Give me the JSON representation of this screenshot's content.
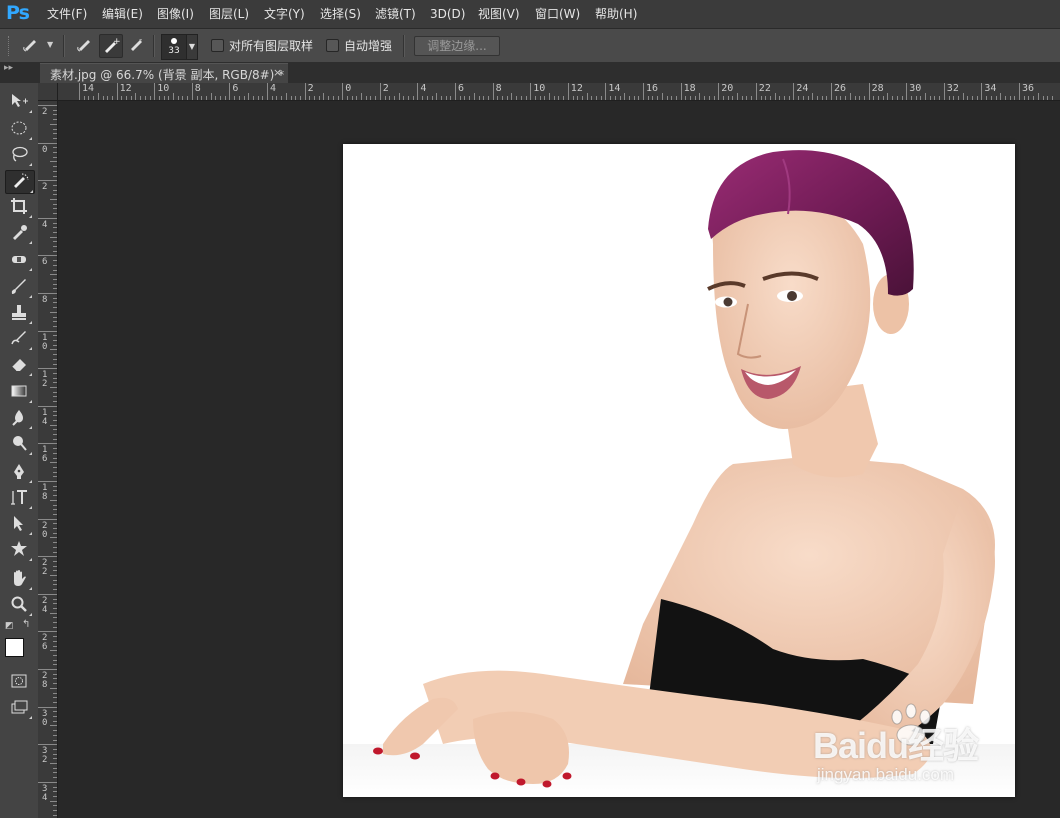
{
  "app": {
    "logo": "Ps"
  },
  "menu": [
    {
      "label": "文件(F)"
    },
    {
      "label": "编辑(E)"
    },
    {
      "label": "图像(I)"
    },
    {
      "label": "图层(L)"
    },
    {
      "label": "文字(Y)"
    },
    {
      "label": "选择(S)"
    },
    {
      "label": "滤镜(T)"
    },
    {
      "label": "3D(D)"
    },
    {
      "label": "视图(V)"
    },
    {
      "label": "窗口(W)"
    },
    {
      "label": "帮助(H)"
    }
  ],
  "options": {
    "brush_size": "33",
    "sample_all_layers": "对所有图层取样",
    "sample_all_layers_checked": false,
    "auto_enhance": "自动增强",
    "auto_enhance_checked": false,
    "refine_edge": "调整边缘..."
  },
  "document": {
    "tab_title": "素材.jpg @ 66.7% (背景 副本, RGB/8#) *",
    "close_glyph": "×"
  },
  "tools": [
    {
      "name": "move-tool",
      "icon": "move-icon"
    },
    {
      "name": "elliptical-marquee-tool",
      "icon": "ellipse-marquee-icon"
    },
    {
      "name": "lasso-tool",
      "icon": "lasso-icon"
    },
    {
      "name": "quick-selection-tool",
      "icon": "quick-selection-icon",
      "active": true
    },
    {
      "name": "crop-tool",
      "icon": "crop-icon"
    },
    {
      "name": "eyedropper-tool",
      "icon": "eyedropper-icon"
    },
    {
      "name": "spot-healing-tool",
      "icon": "bandage-icon"
    },
    {
      "name": "brush-tool",
      "icon": "brush-icon"
    },
    {
      "name": "clone-stamp-tool",
      "icon": "stamp-icon"
    },
    {
      "name": "history-brush-tool",
      "icon": "history-brush-icon"
    },
    {
      "name": "eraser-tool",
      "icon": "eraser-icon"
    },
    {
      "name": "gradient-tool",
      "icon": "gradient-icon"
    },
    {
      "name": "blur-tool",
      "icon": "blur-icon"
    },
    {
      "name": "dodge-tool",
      "icon": "dodge-icon"
    },
    {
      "name": "pen-tool",
      "icon": "pen-icon"
    },
    {
      "name": "type-tool",
      "icon": "type-icon"
    },
    {
      "name": "path-selection-tool",
      "icon": "path-select-icon"
    },
    {
      "name": "custom-shape-tool",
      "icon": "shape-icon"
    },
    {
      "name": "hand-tool",
      "icon": "hand-icon"
    },
    {
      "name": "zoom-tool",
      "icon": "zoom-icon"
    }
  ],
  "colors": {
    "foreground": "#ffffff",
    "background": "#ffffff",
    "hair": "#7a1f5c"
  },
  "ruler_h": [
    "14",
    "12",
    "10",
    "8",
    "6",
    "4",
    "2",
    "0",
    "2",
    "4",
    "6",
    "8",
    "10",
    "12",
    "14",
    "16",
    "18",
    "20",
    "22",
    "24",
    "26",
    "28",
    "30",
    "32",
    "34",
    "36"
  ],
  "ruler_v": [
    "2",
    "0",
    "2",
    "4",
    "6",
    "8",
    "10",
    "12",
    "14",
    "16",
    "18",
    "20",
    "22",
    "24",
    "26",
    "28",
    "30",
    "32",
    "34"
  ],
  "watermark": {
    "brand": "Baidu经验",
    "url": "jingyan.baidu.com"
  }
}
